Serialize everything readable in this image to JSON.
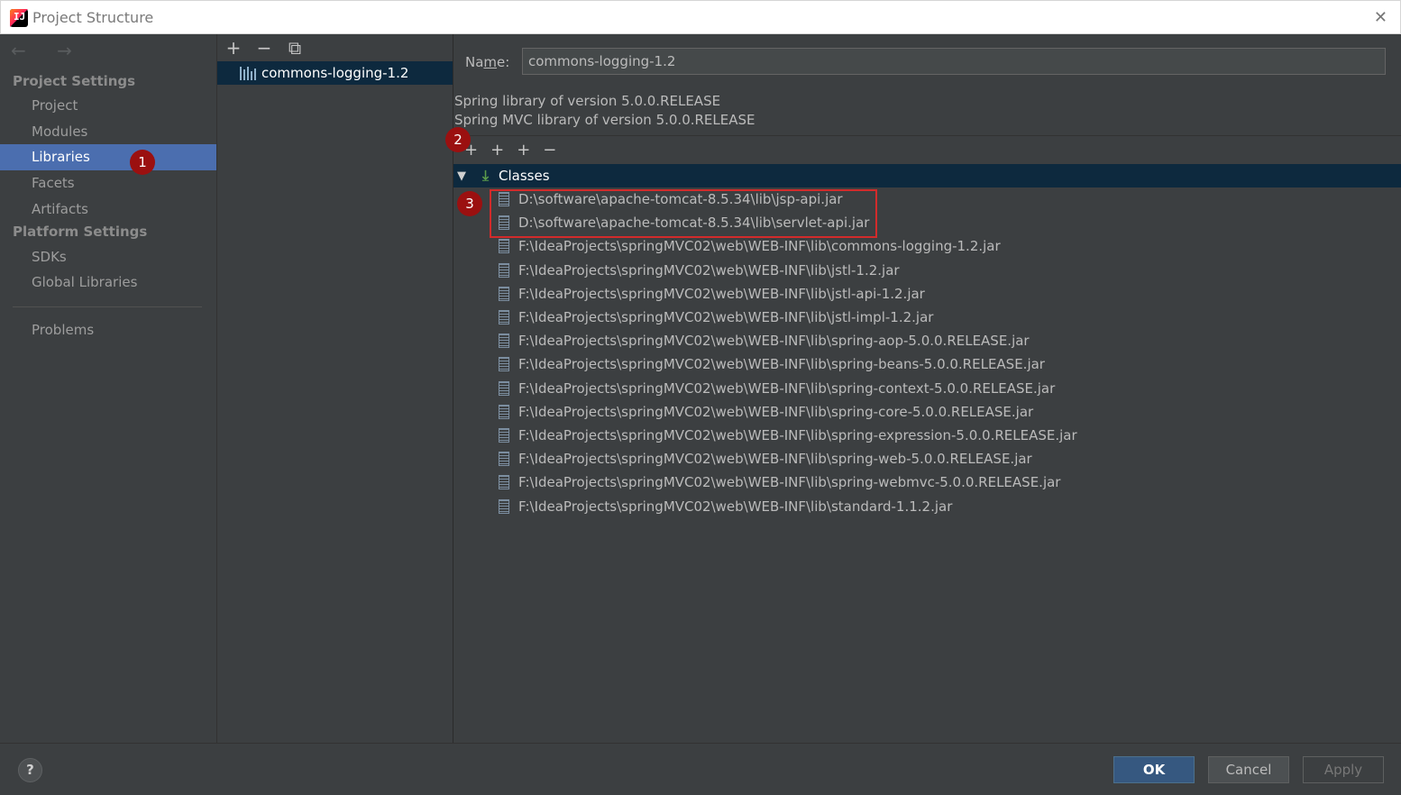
{
  "window": {
    "title": "Project Structure",
    "app_icon_text": "IJ",
    "close_glyph": "✕"
  },
  "nav": {
    "back_forward": "← →",
    "project_settings_header": "Project Settings",
    "project_settings_items": [
      "Project",
      "Modules",
      "Libraries",
      "Facets",
      "Artifacts"
    ],
    "platform_settings_header": "Platform Settings",
    "platform_settings_items": [
      "SDKs",
      "Global Libraries"
    ],
    "problems": "Problems",
    "selected": "Libraries"
  },
  "libraries_list": {
    "toolbar": {
      "add": "+",
      "remove": "−",
      "copy": "⧉"
    },
    "items": [
      "commons-logging-1.2"
    ]
  },
  "detail": {
    "name_label_prefix": "Na",
    "name_label_underlined": "m",
    "name_label_suffix": "e:",
    "name_value": "commons-logging-1.2",
    "descriptions": [
      "Spring library of version 5.0.0.RELEASE",
      "Spring MVC library of version 5.0.0.RELEASE"
    ],
    "toolbar": {
      "add": "+",
      "add_with": "+",
      "add_alt": "+",
      "remove": "−"
    },
    "classes_label": "Classes",
    "jars": [
      "D:\\software\\apache-tomcat-8.5.34\\lib\\jsp-api.jar",
      "D:\\software\\apache-tomcat-8.5.34\\lib\\servlet-api.jar",
      "F:\\IdeaProjects\\springMVC02\\web\\WEB-INF\\lib\\commons-logging-1.2.jar",
      "F:\\IdeaProjects\\springMVC02\\web\\WEB-INF\\lib\\jstl-1.2.jar",
      "F:\\IdeaProjects\\springMVC02\\web\\WEB-INF\\lib\\jstl-api-1.2.jar",
      "F:\\IdeaProjects\\springMVC02\\web\\WEB-INF\\lib\\jstl-impl-1.2.jar",
      "F:\\IdeaProjects\\springMVC02\\web\\WEB-INF\\lib\\spring-aop-5.0.0.RELEASE.jar",
      "F:\\IdeaProjects\\springMVC02\\web\\WEB-INF\\lib\\spring-beans-5.0.0.RELEASE.jar",
      "F:\\IdeaProjects\\springMVC02\\web\\WEB-INF\\lib\\spring-context-5.0.0.RELEASE.jar",
      "F:\\IdeaProjects\\springMVC02\\web\\WEB-INF\\lib\\spring-core-5.0.0.RELEASE.jar",
      "F:\\IdeaProjects\\springMVC02\\web\\WEB-INF\\lib\\spring-expression-5.0.0.RELEASE.jar",
      "F:\\IdeaProjects\\springMVC02\\web\\WEB-INF\\lib\\spring-web-5.0.0.RELEASE.jar",
      "F:\\IdeaProjects\\springMVC02\\web\\WEB-INF\\lib\\spring-webmvc-5.0.0.RELEASE.jar",
      "F:\\IdeaProjects\\springMVC02\\web\\WEB-INF\\lib\\standard-1.1.2.jar"
    ]
  },
  "annotations": {
    "badge1": "1",
    "badge2": "2",
    "badge3": "3"
  },
  "footer": {
    "help": "?",
    "ok": "OK",
    "cancel": "Cancel",
    "apply": "Apply"
  },
  "colors": {
    "selection": "#4b6eaf",
    "tree_selection": "#0d293e",
    "annotation_red": "#d22b2b",
    "background": "#3c3f41"
  }
}
